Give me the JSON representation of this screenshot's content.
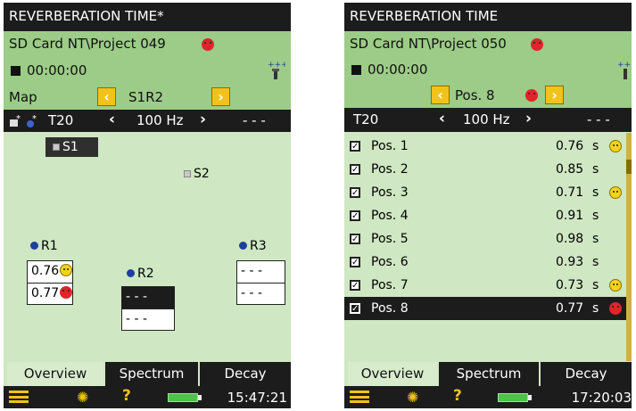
{
  "left": {
    "title": "REVERBERATION TIME*",
    "path": "SD  Card NT\\Project 049",
    "timer": "00:00:00",
    "map_label": "Map",
    "position_label": "S1R2",
    "param": "T20",
    "freq": "100 Hz",
    "dashes": "- - -",
    "sources": [
      {
        "label": "S1"
      },
      {
        "label": "S2"
      }
    ],
    "receivers": [
      {
        "label": "R1",
        "values": [
          "0.76",
          "0.77"
        ]
      },
      {
        "label": "R2",
        "values": [
          "- - -",
          "- - -"
        ]
      },
      {
        "label": "R3",
        "values": [
          "- - -",
          "- - -"
        ]
      }
    ],
    "tabs": [
      "Overview",
      "Spectrum",
      "Decay"
    ],
    "clock": "15:47:21"
  },
  "right": {
    "title": "REVERBERATION TIME",
    "path": "SD  Card NT\\Project 050",
    "timer": "00:00:00",
    "position_label": "Pos. 8",
    "param": "T20",
    "freq": "100 Hz",
    "dashes": "- - -",
    "rows": [
      {
        "name": "Pos. 1",
        "value": "0.76",
        "unit": "s",
        "status": "happy"
      },
      {
        "name": "Pos. 2",
        "value": "0.85",
        "unit": "s",
        "status": ""
      },
      {
        "name": "Pos. 3",
        "value": "0.71",
        "unit": "s",
        "status": "happy"
      },
      {
        "name": "Pos. 4",
        "value": "0.91",
        "unit": "s",
        "status": ""
      },
      {
        "name": "Pos. 5",
        "value": "0.98",
        "unit": "s",
        "status": ""
      },
      {
        "name": "Pos. 6",
        "value": "0.93",
        "unit": "s",
        "status": ""
      },
      {
        "name": "Pos. 7",
        "value": "0.73",
        "unit": "s",
        "status": "happy"
      },
      {
        "name": "Pos. 8",
        "value": "0.77",
        "unit": "s",
        "status": "sad"
      }
    ],
    "tabs": [
      "Overview",
      "Spectrum",
      "Decay"
    ],
    "clock": "17:20:03"
  },
  "colors": {
    "screen_bg": "#cfe7c2",
    "header_green": "#9ccc87",
    "dark_bar": "#1c1c1c",
    "accent_yellow": "#f1c21a",
    "sad_red": "#e0242c",
    "happy_yellow": "#f4d21b",
    "marker_blue": "#1f3fa0"
  },
  "icons": [
    "stop-icon",
    "transducer-icon",
    "chevron-left-icon",
    "chevron-right-icon",
    "menu-icon",
    "brightness-icon",
    "help-icon",
    "battery-icon",
    "checkbox-icon",
    "smiley-happy-icon",
    "smiley-sad-icon"
  ]
}
